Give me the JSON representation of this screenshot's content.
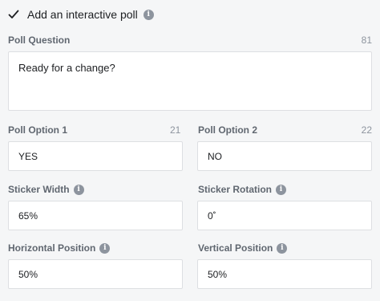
{
  "poll_toggle": {
    "checked": true,
    "label": "Add an interactive poll",
    "info_icon": "info-icon"
  },
  "question": {
    "label": "Poll Question",
    "counter": "81",
    "value": "Ready for a change?"
  },
  "option1": {
    "label": "Poll Option 1",
    "counter": "21",
    "value": "YES"
  },
  "option2": {
    "label": "Poll Option 2",
    "counter": "22",
    "value": "NO"
  },
  "sticker_width": {
    "label": "Sticker Width",
    "value": "65%",
    "info_icon": "info-icon"
  },
  "sticker_rotation": {
    "label": "Sticker Rotation",
    "value": "0˚",
    "info_icon": "info-icon"
  },
  "horizontal_position": {
    "label": "Horizontal Position",
    "value": "50%",
    "info_icon": "info-icon"
  },
  "vertical_position": {
    "label": "Vertical Position",
    "value": "50%",
    "info_icon": "info-icon"
  },
  "colors": {
    "background": "#f5f6f7",
    "label": "#606770",
    "counter": "#8d949e",
    "border": "#dddfe2"
  }
}
